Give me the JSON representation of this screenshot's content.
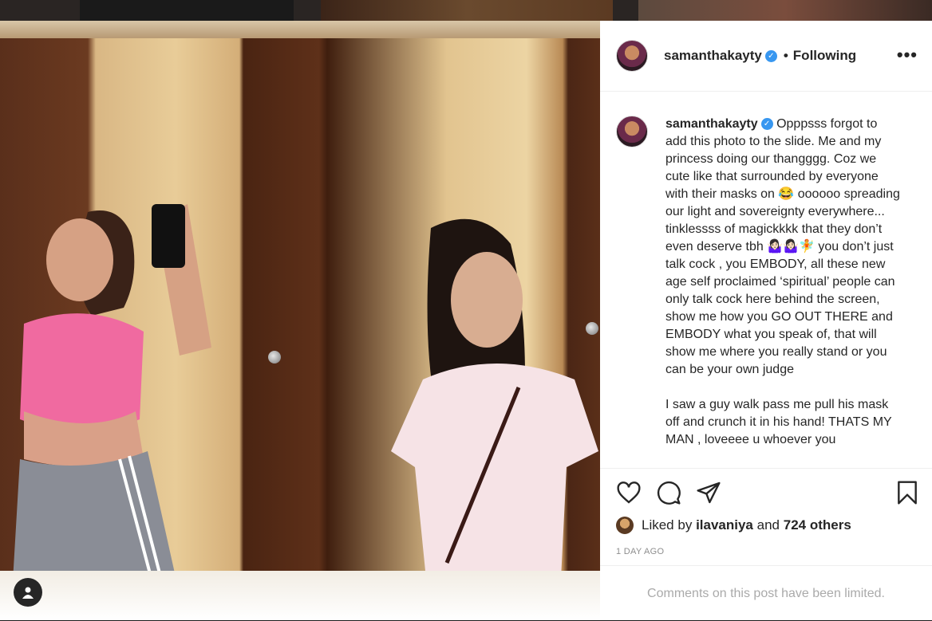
{
  "post": {
    "author": {
      "username": "samanthakayty",
      "verified_icon": "verified-badge-icon",
      "follow_status": "Following",
      "separator": "•"
    },
    "more_icon": "more-options-icon",
    "more_label": "•••",
    "caption": {
      "username": "samanthakayty",
      "text": "Opppsss forgot to add this photo to the slide. Me and my princess doing our thangggg. Coz we cute like that surrounded by everyone with their masks on 😂 oooooo spreading our light and sovereignty everywhere... tinklessss of magickkkk that they don’t even deserve tbh 🤷🏻‍♀️🤷🏻‍♀️🧚 you don’t just talk cock , you EMBODY, all these new age self proclaimed ‘spiritual’ people can only talk cock here behind the screen, show me how you GO OUT THERE and EMBODY what you speak of, that will show me where you really stand or you can be your own judge\n\nI saw a guy walk pass me pull his mask off and crunch it in his hand! THATS MY MAN , loveeee u whoever you"
    },
    "actions": {
      "like_icon": "heart-icon",
      "comment_icon": "comment-icon",
      "share_icon": "share-icon",
      "save_icon": "bookmark-icon"
    },
    "likes": {
      "prefix": "Liked by",
      "user": "ilavaniya",
      "conjunction": "and",
      "others": "724 others"
    },
    "date": "1 DAY AGO",
    "comments_notice": "Comments on this post have been limited.",
    "user_tags_icon": "user-tag-icon"
  },
  "colors": {
    "verified": "#3897f0",
    "text": "#262626",
    "secondary": "#8e8e8e",
    "border": "#efefef"
  }
}
